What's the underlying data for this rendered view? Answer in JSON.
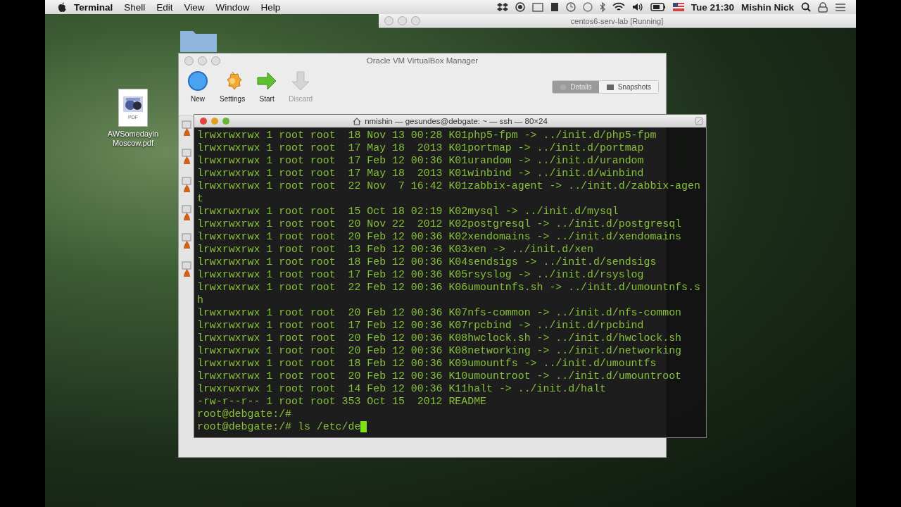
{
  "menu_bar": {
    "app_name": "Terminal",
    "menus": [
      "Shell",
      "Edit",
      "View",
      "Window",
      "Help"
    ],
    "clock": "Tue 21:30",
    "user": "Mishin Nick"
  },
  "background_window": {
    "title": "centos6-serv-lab [Running]"
  },
  "desktop_icons": [
    {
      "label": "AWSomedayinMoscow.pdf",
      "badge": "PDF"
    }
  ],
  "vbox_manager": {
    "title": "Oracle VM VirtualBox Manager",
    "toolbar": [
      {
        "kind": "new",
        "label": "New",
        "disabled": false
      },
      {
        "kind": "settings",
        "label": "Settings",
        "disabled": false
      },
      {
        "kind": "start",
        "label": "Start",
        "disabled": false
      },
      {
        "kind": "discard",
        "label": "Discard",
        "disabled": true
      }
    ],
    "view_tabs": [
      {
        "label": "Details",
        "selected": true
      },
      {
        "label": "Snapshots",
        "selected": false
      }
    ]
  },
  "terminal": {
    "title": "nmishin — gesundes@debgate: ~ — ssh — 80×24",
    "lines": [
      "lrwxrwxrwx 1 root root  18 Nov 13 00:28 K01php5-fpm -> ../init.d/php5-fpm",
      "lrwxrwxrwx 1 root root  17 May 18  2013 K01portmap -> ../init.d/portmap",
      "lrwxrwxrwx 1 root root  17 Feb 12 00:36 K01urandom -> ../init.d/urandom",
      "lrwxrwxrwx 1 root root  17 May 18  2013 K01winbind -> ../init.d/winbind",
      "lrwxrwxrwx 1 root root  22 Nov  7 16:42 K01zabbix-agent -> ../init.d/zabbix-agen",
      "t",
      "lrwxrwxrwx 1 root root  15 Oct 18 02:19 K02mysql -> ../init.d/mysql",
      "lrwxrwxrwx 1 root root  20 Nov 22  2012 K02postgresql -> ../init.d/postgresql",
      "lrwxrwxrwx 1 root root  20 Feb 12 00:36 K02xendomains -> ../init.d/xendomains",
      "lrwxrwxrwx 1 root root  13 Feb 12 00:36 K03xen -> ../init.d/xen",
      "lrwxrwxrwx 1 root root  18 Feb 12 00:36 K04sendsigs -> ../init.d/sendsigs",
      "lrwxrwxrwx 1 root root  17 Feb 12 00:36 K05rsyslog -> ../init.d/rsyslog",
      "lrwxrwxrwx 1 root root  22 Feb 12 00:36 K06umountnfs.sh -> ../init.d/umountnfs.s",
      "h",
      "lrwxrwxrwx 1 root root  20 Feb 12 00:36 K07nfs-common -> ../init.d/nfs-common",
      "lrwxrwxrwx 1 root root  17 Feb 12 00:36 K07rpcbind -> ../init.d/rpcbind",
      "lrwxrwxrwx 1 root root  20 Feb 12 00:36 K08hwclock.sh -> ../init.d/hwclock.sh",
      "lrwxrwxrwx 1 root root  20 Feb 12 00:36 K08networking -> ../init.d/networking",
      "lrwxrwxrwx 1 root root  18 Feb 12 00:36 K09umountfs -> ../init.d/umountfs",
      "lrwxrwxrwx 1 root root  20 Feb 12 00:36 K10umountroot -> ../init.d/umountroot",
      "lrwxrwxrwx 1 root root  14 Feb 12 00:36 K11halt -> ../init.d/halt",
      "-rw-r--r-- 1 root root 353 Oct 15  2012 README",
      "root@debgate:/#"
    ],
    "input": "root@debgate:/# ls /etc/de"
  }
}
